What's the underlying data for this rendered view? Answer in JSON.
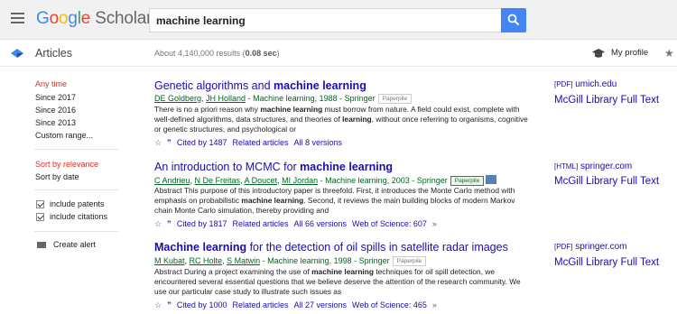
{
  "header": {
    "logo_google": [
      "G",
      "o",
      "o",
      "g",
      "l",
      "e"
    ],
    "logo_scholar": "Scholar",
    "search_query": "machine learning"
  },
  "subbar": {
    "section_label": "Articles",
    "results_count": "About 4,140,000 results (",
    "results_time": "0.08 sec",
    "results_close": ")",
    "my_profile": "My profile"
  },
  "sidebar": {
    "time_filters": [
      "Any time",
      "Since 2017",
      "Since 2016",
      "Since 2013",
      "Custom range..."
    ],
    "sort_options": [
      "Sort by relevance",
      "Sort by date"
    ],
    "include_options": [
      "include patents",
      "include citations"
    ],
    "create_alert": "Create alert"
  },
  "results": [
    {
      "title_pre": "Genetic algorithms and ",
      "title_bold": "machine learning",
      "title_post": "",
      "authors": [
        "DE Goldberg",
        "JH Holland"
      ],
      "venue": " - Machine learning, 1988 - Springer",
      "paperpile": "Paperpile",
      "paperpile_green": false,
      "snippet_html": "There is no a priori reason why <b>machine learning</b> must borrow from nature. A field could exist, complete with well-defined algorithms, data structures, and theories of <b>learning</b>, without once referring to organisms, cognitive or genetic structures, and psychological or",
      "actions": [
        "Cited by 1487",
        "Related articles",
        "All 8 versions"
      ],
      "right_tag": "[PDF]",
      "right_domain": "umich.edu",
      "right_link": "McGill Library Full Text"
    },
    {
      "title_pre": "An introduction to MCMC for ",
      "title_bold": "machine learning",
      "title_post": "",
      "authors": [
        "C Andrieu",
        "N De Freitas",
        "A Doucet",
        "MI Jordan"
      ],
      "venue": " - Machine learning, 2003 - Springer",
      "paperpile": "Paperpile",
      "paperpile_green": true,
      "snippet_html": "Abstract This purpose of this introductory paper is threefold. First, it introduces the Monte Carlo method with emphasis on probabilistic <b>machine learning</b>. Second, it reviews the main building blocks of modern Markov chain Monte Carlo simulation, thereby providing and",
      "actions": [
        "Cited by 1817",
        "Related articles",
        "All 66 versions",
        "Web of Science: 607"
      ],
      "right_tag": "[HTML]",
      "right_domain": "springer.com",
      "right_link": "McGill Library Full Text"
    },
    {
      "title_pre": "",
      "title_bold": "Machine learning",
      "title_post": " for the detection of oil spills in satellite radar images",
      "authors": [
        "M Kubat",
        "RC Holte",
        "S Matwin"
      ],
      "venue": " - Machine learning, 1998 - Springer",
      "paperpile": "Paperpile",
      "paperpile_green": false,
      "snippet_html": "Abstract During a project examining the use of <b>machine learning</b> techniques for oil spill detection, we encountered several essential questions that we believe deserve the attention of the research community. We use our particular case study to illustrate such issues as",
      "actions": [
        "Cited by 1000",
        "Related articles",
        "All 27 versions",
        "Web of Science: 465"
      ],
      "right_tag": "[PDF]",
      "right_domain": "springer.com",
      "right_link": "McGill Library Full Text"
    }
  ]
}
